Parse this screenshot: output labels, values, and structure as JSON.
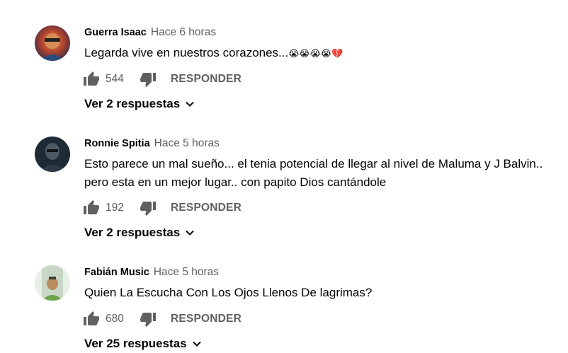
{
  "comments": [
    {
      "author": "Guerra Isaac",
      "time": "Hace 6 horas",
      "text": "Legarda vive en nuestros corazones...",
      "emoji": "😭😭😭😭💔",
      "likes": "544",
      "reply_label": "RESPONDER",
      "replies_label": "Ver 2 respuestas",
      "avatar_icon": "user-avatar"
    },
    {
      "author": "Ronnie Spitia",
      "time": "Hace 5 horas",
      "text": "Esto parece un mal sueño... el tenia potencial de llegar al nivel de Maluma y J Balvin.. pero esta en un mejor lugar.. con papito Dios cantándole",
      "likes": "192",
      "reply_label": "RESPONDER",
      "replies_label": "Ver 2 respuestas",
      "avatar_icon": "user-avatar"
    },
    {
      "author": "Fabián Music",
      "time": "Hace 5 horas",
      "text": "Quien La Escucha Con Los Ojos Llenos De lagrimas?",
      "likes": "680",
      "reply_label": "RESPONDER",
      "replies_label": "Ver 25 respuestas",
      "avatar_icon": "user-avatar"
    }
  ],
  "colors": {
    "primary_text": "#030303",
    "secondary_text": "#606060",
    "icon": "#606060"
  }
}
